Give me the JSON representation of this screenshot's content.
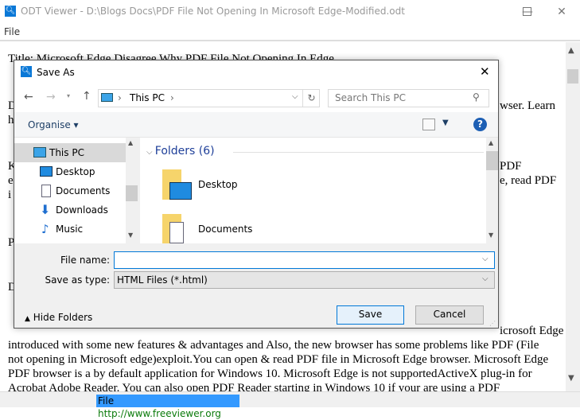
{
  "window": {
    "title": "ODT Viewer - D:\\Blogs Docs\\PDF File Not Opening In Microsoft Edge-Modified.odt",
    "minimize": "—",
    "maximize": "☐",
    "close": "✕"
  },
  "menu": {
    "file": "File"
  },
  "document": {
    "frag_title": "Title: Microsoft Edge Disagree Why PDF File Not Opening In Edge",
    "frag_d1": "D",
    "frag_learn": "wser. Learn",
    "frag_h": "h",
    "frag_k": "K",
    "frag_pdf": "PDF",
    "frag_e": "e",
    "frag_read": "e, read PDF",
    "frag_i": "i",
    "frag_p": "P",
    "frag_d2": "D",
    "frag_edge": "icrosoft Edge",
    "line1": "introduced with some new features & advantages and Also, the new browser has some problems like PDF (File",
    "line2": "not opening in Microsoft edge)exploit.You can open & read PDF file in Microsoft Edge browser. Microsoft Edge",
    "line3": "PDF browser is a by default application for Windows 10. Microsoft Edge is not supportedActiveX plug-in for",
    "line4": "Acrobat Adobe Reader. You can also open PDF Reader starting in Windows 10 if your are using a PDF"
  },
  "statusbar": {
    "file": "File",
    "link": "http://www.freeviewer.org"
  },
  "dialog": {
    "title": "Save As",
    "close": "✕",
    "breadcrumb": [
      "This PC"
    ],
    "search_placeholder": "Search This PC",
    "organise": "Organise ▾",
    "nav_items": [
      {
        "label": "This PC",
        "icon": "computer-icon"
      },
      {
        "label": "Desktop",
        "icon": "desktop-icon"
      },
      {
        "label": "Documents",
        "icon": "documents-icon"
      },
      {
        "label": "Downloads",
        "icon": "downloads-icon"
      },
      {
        "label": "Music",
        "icon": "music-icon"
      }
    ],
    "group_header": "Folders (6)",
    "folders": [
      "Desktop",
      "Documents"
    ],
    "file_name_label": "File name:",
    "file_name_value": "",
    "save_type_label": "Save as type:",
    "save_type_value": "HTML Files (*.html)",
    "hide_folders": "Hide Folders",
    "save": "Save",
    "cancel": "Cancel",
    "colors": {
      "accent": "#0078d7",
      "folder": "#f6d46b"
    }
  }
}
